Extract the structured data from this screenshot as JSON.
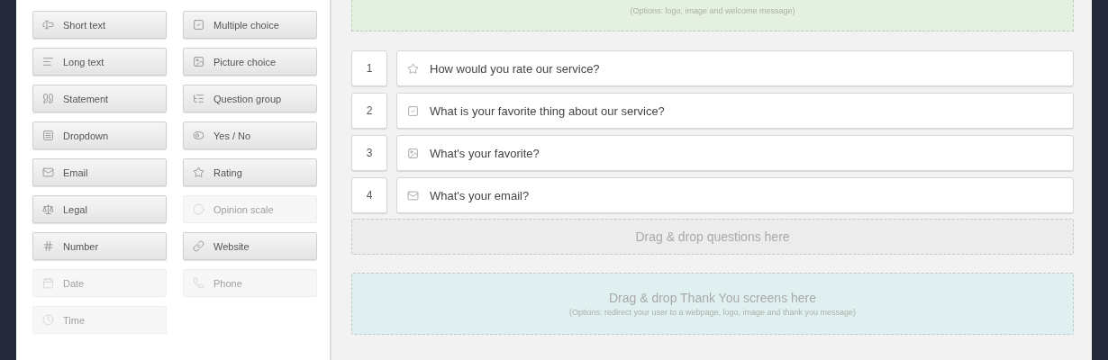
{
  "field_types": [
    {
      "label": "Short text",
      "kind": "short-text",
      "disabled": false
    },
    {
      "label": "Multiple choice",
      "kind": "multiple-choice",
      "disabled": false
    },
    {
      "label": "Long text",
      "kind": "long-text",
      "disabled": false
    },
    {
      "label": "Picture choice",
      "kind": "picture-choice",
      "disabled": false
    },
    {
      "label": "Statement",
      "kind": "statement",
      "disabled": false
    },
    {
      "label": "Question group",
      "kind": "question-group",
      "disabled": false
    },
    {
      "label": "Dropdown",
      "kind": "dropdown",
      "disabled": false
    },
    {
      "label": "Yes / No",
      "kind": "yes-no",
      "disabled": false
    },
    {
      "label": "Email",
      "kind": "email",
      "disabled": false
    },
    {
      "label": "Rating",
      "kind": "rating",
      "disabled": false
    },
    {
      "label": "Legal",
      "kind": "legal",
      "disabled": false
    },
    {
      "label": "Opinion scale",
      "kind": "opinion-scale",
      "disabled": true
    },
    {
      "label": "Number",
      "kind": "number",
      "disabled": false
    },
    {
      "label": "Website",
      "kind": "website",
      "disabled": false
    },
    {
      "label": "Date",
      "kind": "date",
      "disabled": true
    },
    {
      "label": "Phone",
      "kind": "phone",
      "disabled": true
    },
    {
      "label": "Time",
      "kind": "time",
      "disabled": true
    }
  ],
  "welcome_zone": {
    "subtitle": "(Options: logo, image and welcome message)"
  },
  "questions": [
    {
      "number": "1",
      "kind": "rating",
      "text": "How would you rate our service?"
    },
    {
      "number": "2",
      "kind": "multiple-choice",
      "text": "What is your favorite thing about our service?"
    },
    {
      "number": "3",
      "kind": "picture-choice",
      "text": "What's your favorite?"
    },
    {
      "number": "4",
      "kind": "email",
      "text": "What's your email?"
    }
  ],
  "questions_zone": {
    "title": "Drag & drop questions here"
  },
  "thank_you_zone": {
    "title": "Drag & drop Thank You screens here",
    "subtitle": "(Options: redirect your user to a webpage, logo, image and thank you message)"
  }
}
